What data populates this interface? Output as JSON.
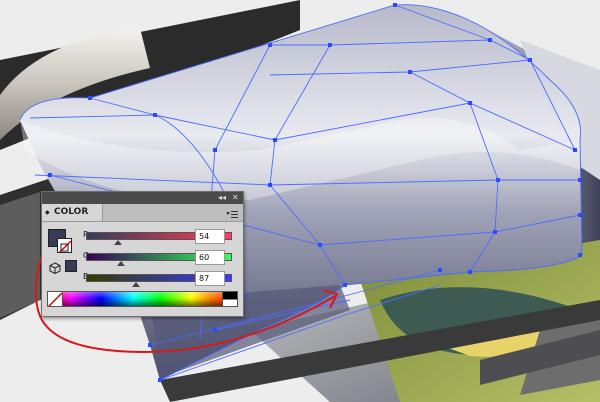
{
  "panel": {
    "collapse_glyph": "◂◂",
    "close_glyph": "✕",
    "tab_arrows": "◆",
    "tab_label": "COLOR",
    "channels": [
      {
        "label": "R",
        "value": "54",
        "level": 0.212
      },
      {
        "label": "G",
        "value": "60",
        "level": 0.235
      },
      {
        "label": "B",
        "value": "87",
        "level": 0.341
      }
    ],
    "fill_color": "#363c57",
    "out_of_gamut_color": "#363c57"
  },
  "colors": {
    "annotation_arrow": "#d41a1a",
    "mesh_lines": "#4a6cff"
  },
  "icons": [
    "panel-menu-icon",
    "cube-warning-icon",
    "none-swatch-icon",
    "fill-swatch-icon",
    "stroke-swatch-icon"
  ]
}
